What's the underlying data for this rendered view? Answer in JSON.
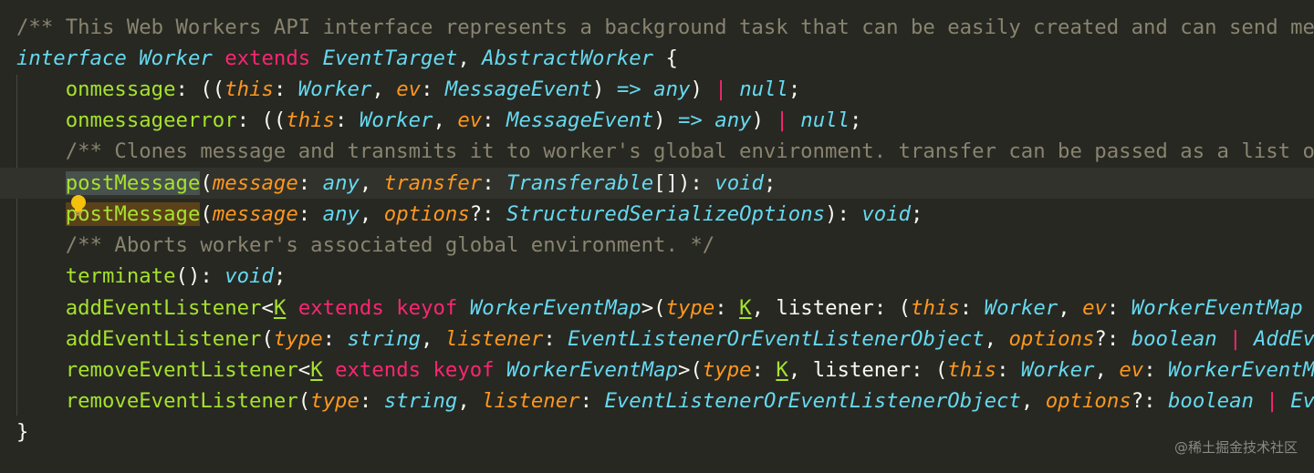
{
  "editor": {
    "lines": [
      {
        "tokens": [
          {
            "t": "/** This Web Workers API interface represents a background task that can be easily created and can send messages back to its creator. */",
            "c": "comment"
          }
        ]
      },
      {
        "tokens": [
          {
            "t": "interface ",
            "c": "storage"
          },
          {
            "t": "Worker",
            "c": "type"
          },
          {
            "t": " ",
            "c": "punct"
          },
          {
            "t": "extends",
            "c": "keyword"
          },
          {
            "t": " ",
            "c": "punct"
          },
          {
            "t": "EventTarget",
            "c": "type"
          },
          {
            "t": ", ",
            "c": "punct"
          },
          {
            "t": "AbstractWorker",
            "c": "type"
          },
          {
            "t": " {",
            "c": "punct"
          }
        ]
      },
      {
        "tokens": [
          {
            "t": "    ",
            "c": "punct"
          },
          {
            "t": "onmessage",
            "c": "member"
          },
          {
            "t": ": ((",
            "c": "punct"
          },
          {
            "t": "this",
            "c": "param"
          },
          {
            "t": ": ",
            "c": "punct"
          },
          {
            "t": "Worker",
            "c": "type"
          },
          {
            "t": ", ",
            "c": "punct"
          },
          {
            "t": "ev",
            "c": "param"
          },
          {
            "t": ": ",
            "c": "punct"
          },
          {
            "t": "MessageEvent",
            "c": "type"
          },
          {
            "t": ") ",
            "c": "punct"
          },
          {
            "t": "=>",
            "c": "storage"
          },
          {
            "t": " ",
            "c": "punct"
          },
          {
            "t": "any",
            "c": "type"
          },
          {
            "t": ") ",
            "c": "punct"
          },
          {
            "t": "|",
            "c": "op"
          },
          {
            "t": " ",
            "c": "punct"
          },
          {
            "t": "null",
            "c": "type"
          },
          {
            "t": ";",
            "c": "punct"
          }
        ]
      },
      {
        "tokens": [
          {
            "t": "    ",
            "c": "punct"
          },
          {
            "t": "onmessageerror",
            "c": "member"
          },
          {
            "t": ": ((",
            "c": "punct"
          },
          {
            "t": "this",
            "c": "param"
          },
          {
            "t": ": ",
            "c": "punct"
          },
          {
            "t": "Worker",
            "c": "type"
          },
          {
            "t": ", ",
            "c": "punct"
          },
          {
            "t": "ev",
            "c": "param"
          },
          {
            "t": ": ",
            "c": "punct"
          },
          {
            "t": "MessageEvent",
            "c": "type"
          },
          {
            "t": ") ",
            "c": "punct"
          },
          {
            "t": "=>",
            "c": "storage"
          },
          {
            "t": " ",
            "c": "punct"
          },
          {
            "t": "any",
            "c": "type"
          },
          {
            "t": ") ",
            "c": "punct"
          },
          {
            "t": "|",
            "c": "op"
          },
          {
            "t": " ",
            "c": "punct"
          },
          {
            "t": "null",
            "c": "type"
          },
          {
            "t": ";",
            "c": "punct"
          }
        ]
      },
      {
        "tokens": [
          {
            "t": "    ",
            "c": "punct"
          },
          {
            "t": "/** Clones message and transmits it to worker's global environment. transfer can be passed as a list of objects that are to be transferred rather than cloned. */",
            "c": "comment"
          }
        ]
      },
      {
        "tokens": [
          {
            "t": "    ",
            "c": "punct"
          },
          {
            "t": "postMessage",
            "c": "member",
            "hl": "hl-read"
          },
          {
            "t": "(",
            "c": "punct"
          },
          {
            "t": "message",
            "c": "param"
          },
          {
            "t": ": ",
            "c": "punct"
          },
          {
            "t": "any",
            "c": "type"
          },
          {
            "t": ", ",
            "c": "punct"
          },
          {
            "t": "transfer",
            "c": "param"
          },
          {
            "t": ": ",
            "c": "punct"
          },
          {
            "t": "Transferable",
            "c": "type"
          },
          {
            "t": "[]): ",
            "c": "punct"
          },
          {
            "t": "void",
            "c": "type"
          },
          {
            "t": ";",
            "c": "punct"
          }
        ]
      },
      {
        "tokens": [
          {
            "t": "    ",
            "c": "punct"
          },
          {
            "t": "postMessage",
            "c": "member",
            "hl": "hl-write"
          },
          {
            "t": "(",
            "c": "punct"
          },
          {
            "t": "message",
            "c": "param"
          },
          {
            "t": ": ",
            "c": "punct"
          },
          {
            "t": "any",
            "c": "type"
          },
          {
            "t": ", ",
            "c": "punct"
          },
          {
            "t": "options",
            "c": "param"
          },
          {
            "t": "?: ",
            "c": "punct"
          },
          {
            "t": "StructuredSerializeOptions",
            "c": "type"
          },
          {
            "t": "): ",
            "c": "punct"
          },
          {
            "t": "void",
            "c": "type"
          },
          {
            "t": ";",
            "c": "punct"
          }
        ]
      },
      {
        "tokens": [
          {
            "t": "    ",
            "c": "punct"
          },
          {
            "t": "/** Aborts worker's associated global environment. */",
            "c": "comment"
          }
        ]
      },
      {
        "tokens": [
          {
            "t": "    ",
            "c": "punct"
          },
          {
            "t": "terminate",
            "c": "member"
          },
          {
            "t": "(): ",
            "c": "punct"
          },
          {
            "t": "void",
            "c": "type"
          },
          {
            "t": ";",
            "c": "punct"
          }
        ]
      },
      {
        "tokens": [
          {
            "t": "    ",
            "c": "punct"
          },
          {
            "t": "addEventListener",
            "c": "member"
          },
          {
            "t": "<",
            "c": "punct"
          },
          {
            "t": "K",
            "c": "tparam"
          },
          {
            "t": " ",
            "c": "punct"
          },
          {
            "t": "extends",
            "c": "keyword"
          },
          {
            "t": " ",
            "c": "punct"
          },
          {
            "t": "keyof",
            "c": "keyword"
          },
          {
            "t": " ",
            "c": "punct"
          },
          {
            "t": "WorkerEventMap",
            "c": "type"
          },
          {
            "t": ">(",
            "c": "punct"
          },
          {
            "t": "type",
            "c": "param"
          },
          {
            "t": ": ",
            "c": "punct"
          },
          {
            "t": "K",
            "c": "tparam"
          },
          {
            "t": ", listener: (",
            "c": "punct"
          },
          {
            "t": "this",
            "c": "param"
          },
          {
            "t": ": ",
            "c": "punct"
          },
          {
            "t": "Worker",
            "c": "type"
          },
          {
            "t": ", ",
            "c": "punct"
          },
          {
            "t": "ev",
            "c": "param"
          },
          {
            "t": ": ",
            "c": "punct"
          },
          {
            "t": "WorkerEventMap",
            "c": "type"
          }
        ]
      },
      {
        "tokens": [
          {
            "t": "    ",
            "c": "punct"
          },
          {
            "t": "addEventListener",
            "c": "member"
          },
          {
            "t": "(",
            "c": "punct"
          },
          {
            "t": "type",
            "c": "param"
          },
          {
            "t": ": ",
            "c": "punct"
          },
          {
            "t": "string",
            "c": "type"
          },
          {
            "t": ", ",
            "c": "punct"
          },
          {
            "t": "listener",
            "c": "param"
          },
          {
            "t": ": ",
            "c": "punct"
          },
          {
            "t": "EventListenerOrEventListenerObject",
            "c": "type"
          },
          {
            "t": ", ",
            "c": "punct"
          },
          {
            "t": "options",
            "c": "param"
          },
          {
            "t": "?: ",
            "c": "punct"
          },
          {
            "t": "boolean",
            "c": "type"
          },
          {
            "t": " ",
            "c": "punct"
          },
          {
            "t": "|",
            "c": "op"
          },
          {
            "t": " ",
            "c": "punct"
          },
          {
            "t": "AddEventListenerOptions",
            "c": "type"
          }
        ]
      },
      {
        "tokens": [
          {
            "t": "    ",
            "c": "punct"
          },
          {
            "t": "removeEventListener",
            "c": "member"
          },
          {
            "t": "<",
            "c": "punct"
          },
          {
            "t": "K",
            "c": "tparam"
          },
          {
            "t": " ",
            "c": "punct"
          },
          {
            "t": "extends",
            "c": "keyword"
          },
          {
            "t": " ",
            "c": "punct"
          },
          {
            "t": "keyof",
            "c": "keyword"
          },
          {
            "t": " ",
            "c": "punct"
          },
          {
            "t": "WorkerEventMap",
            "c": "type"
          },
          {
            "t": ">(",
            "c": "punct"
          },
          {
            "t": "type",
            "c": "param"
          },
          {
            "t": ": ",
            "c": "punct"
          },
          {
            "t": "K",
            "c": "tparam"
          },
          {
            "t": ", listener: (",
            "c": "punct"
          },
          {
            "t": "this",
            "c": "param"
          },
          {
            "t": ": ",
            "c": "punct"
          },
          {
            "t": "Worker",
            "c": "type"
          },
          {
            "t": ", ",
            "c": "punct"
          },
          {
            "t": "ev",
            "c": "param"
          },
          {
            "t": ": ",
            "c": "punct"
          },
          {
            "t": "WorkerEventMap",
            "c": "type"
          }
        ]
      },
      {
        "tokens": [
          {
            "t": "    ",
            "c": "punct"
          },
          {
            "t": "removeEventListener",
            "c": "member"
          },
          {
            "t": "(",
            "c": "punct"
          },
          {
            "t": "type",
            "c": "param"
          },
          {
            "t": ": ",
            "c": "punct"
          },
          {
            "t": "string",
            "c": "type"
          },
          {
            "t": ", ",
            "c": "punct"
          },
          {
            "t": "listener",
            "c": "param"
          },
          {
            "t": ": ",
            "c": "punct"
          },
          {
            "t": "EventListenerOrEventListenerObject",
            "c": "type"
          },
          {
            "t": ", ",
            "c": "punct"
          },
          {
            "t": "options",
            "c": "param"
          },
          {
            "t": "?: ",
            "c": "punct"
          },
          {
            "t": "boolean",
            "c": "type"
          },
          {
            "t": " ",
            "c": "punct"
          },
          {
            "t": "|",
            "c": "op"
          },
          {
            "t": " ",
            "c": "punct"
          },
          {
            "t": "EventListenerOptions",
            "c": "type"
          }
        ]
      },
      {
        "tokens": [
          {
            "t": "}",
            "c": "punct"
          }
        ]
      }
    ]
  },
  "watermark": "@稀土掘金技术社区",
  "colors": {
    "background": "#272822",
    "comment": "#88846f",
    "keyword": "#f92672",
    "type": "#66d9ef",
    "param": "#fd971f",
    "member": "#a6e22e",
    "text": "#f8f8f2"
  },
  "icons": {
    "gutter": "lightbulb-icon"
  }
}
